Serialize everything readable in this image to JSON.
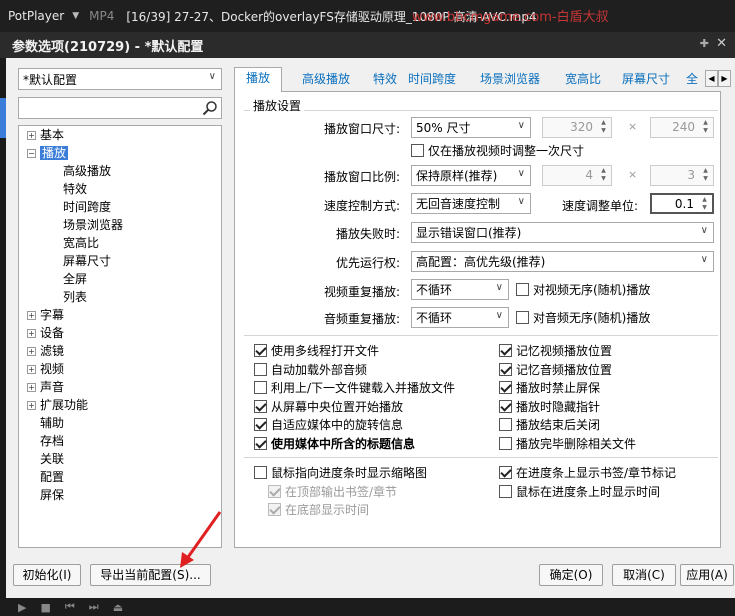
{
  "player": {
    "app_name": "PotPlayer",
    "format": "MP4",
    "title": "[16/39] 27-27、Docker的overlayFS存储驱动原理_1080P 高清-AVC.mp4",
    "watermark": "www.bbcmgame.com-白盾大叔"
  },
  "dialog": {
    "title": "参数选项(210729) - *默认配置",
    "pin_icon": "pin-icon",
    "close_icon": "close-icon"
  },
  "profile": {
    "value": "*默认配置"
  },
  "search": {
    "value": "",
    "icon": "search-icon"
  },
  "tree": {
    "items": [
      {
        "label": "基本",
        "indent": 0,
        "expander": "+"
      },
      {
        "label": "播放",
        "indent": 0,
        "expander": "−",
        "selected": true
      },
      {
        "label": "高级播放",
        "indent": 1
      },
      {
        "label": "特效",
        "indent": 1
      },
      {
        "label": "时间跨度",
        "indent": 1
      },
      {
        "label": "场景浏览器",
        "indent": 1
      },
      {
        "label": "宽高比",
        "indent": 1
      },
      {
        "label": "屏幕尺寸",
        "indent": 1
      },
      {
        "label": "全屏",
        "indent": 1
      },
      {
        "label": "列表",
        "indent": 1
      },
      {
        "label": "字幕",
        "indent": 0,
        "expander": "+"
      },
      {
        "label": "设备",
        "indent": 0,
        "expander": "+"
      },
      {
        "label": "滤镜",
        "indent": 0,
        "expander": "+"
      },
      {
        "label": "视频",
        "indent": 0,
        "expander": "+"
      },
      {
        "label": "声音",
        "indent": 0,
        "expander": "+"
      },
      {
        "label": "扩展功能",
        "indent": 0,
        "expander": "+"
      },
      {
        "label": "辅助",
        "indent": 0
      },
      {
        "label": "存档",
        "indent": 0
      },
      {
        "label": "关联",
        "indent": 0
      },
      {
        "label": "配置",
        "indent": 0
      },
      {
        "label": "屏保",
        "indent": 0
      }
    ]
  },
  "tabs": [
    "播放",
    "高级播放",
    "特效",
    "时间跨度",
    "场景浏览器",
    "宽高比",
    "屏幕尺寸",
    "全"
  ],
  "playback": {
    "group_title": "播放设置",
    "window_size": {
      "label": "播放窗口尺寸:",
      "value": "50% 尺寸",
      "width": "320",
      "height": "240"
    },
    "resize_once": {
      "label": "仅在播放视频时调整一次尺寸",
      "checked": false
    },
    "aspect": {
      "label": "播放窗口比例:",
      "value": "保持原样(推荐)",
      "w": "4",
      "h": "3"
    },
    "speed": {
      "label": "速度控制方式:",
      "value": "无回音速度控制",
      "unit_label": "速度调整单位:",
      "unit_value": "0.1"
    },
    "fail": {
      "label": "播放失败时:",
      "value": "显示错误窗口(推荐)"
    },
    "priority": {
      "label": "优先运行权:",
      "value": "高配置：高优先级(推荐)"
    },
    "video_repeat": {
      "label": "视频重复播放:",
      "value": "不循环",
      "check_label": "对视频无序(随机)播放",
      "checked": false
    },
    "audio_repeat": {
      "label": "音频重复播放:",
      "value": "不循环",
      "check_label": "对音频无序(随机)播放",
      "checked": false
    },
    "times_symbol": "×"
  },
  "options_left": [
    {
      "label": "使用多线程打开文件",
      "checked": true
    },
    {
      "label": "自动加载外部音频",
      "checked": false
    },
    {
      "label": "利用上/下一文件键载入并播放文件",
      "checked": false
    },
    {
      "label": "从屏幕中央位置开始播放",
      "checked": true
    },
    {
      "label": "自适应媒体中的旋转信息",
      "checked": true
    },
    {
      "label": "使用媒体中所含的标题信息",
      "checked": true,
      "bold": true
    }
  ],
  "options_right": [
    {
      "label": "记忆视频播放位置",
      "checked": true
    },
    {
      "label": "记忆音频播放位置",
      "checked": true
    },
    {
      "label": "播放时禁止屏保",
      "checked": true
    },
    {
      "label": "播放时隐藏指针",
      "checked": true
    },
    {
      "label": "播放结束后关闭",
      "checked": false
    },
    {
      "label": "播放完毕删除相关文件",
      "checked": false
    }
  ],
  "thumb_left": [
    {
      "label": "鼠标指向进度条时显示缩略图",
      "checked": false
    },
    {
      "label": "在顶部输出书签/章节",
      "checked": true,
      "disabled": true
    },
    {
      "label": "在底部显示时间",
      "checked": true,
      "disabled": true
    }
  ],
  "thumb_right": [
    {
      "label": "在进度条上显示书签/章节标记",
      "checked": true
    },
    {
      "label": "鼠标在进度条上时显示时间",
      "checked": false
    }
  ],
  "buttons": {
    "reset": "初始化(I)",
    "export": "导出当前配置(S)...",
    "ok": "确定(O)",
    "cancel": "取消(C)",
    "apply": "应用(A)"
  },
  "colors": {
    "accent": "#3b7dd8",
    "tab_text": "#0a6fbd",
    "annotation_arrow": "#e02020"
  }
}
